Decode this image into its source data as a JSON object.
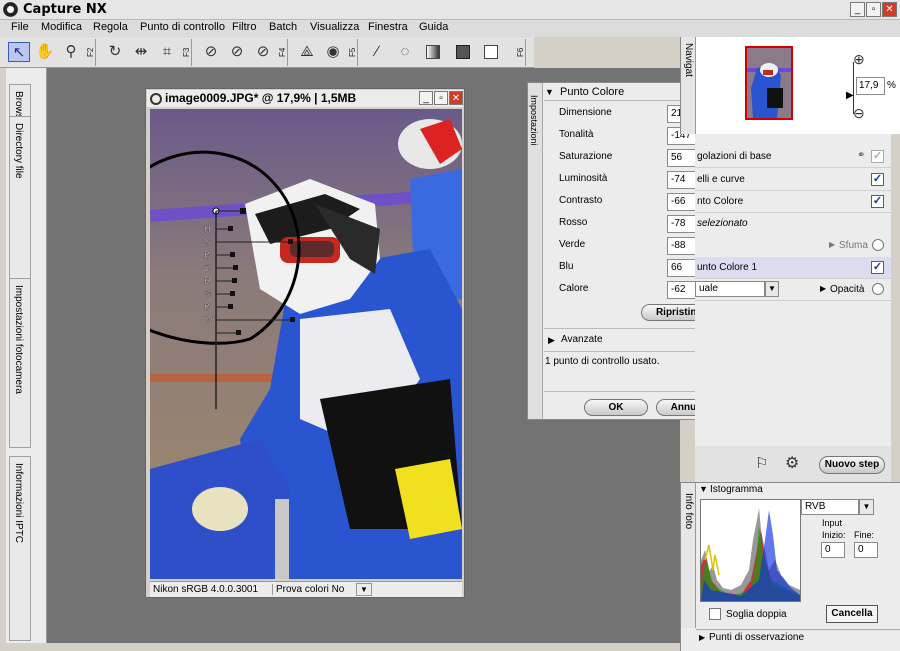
{
  "app": {
    "title": "Capture NX"
  },
  "window_controls": {
    "minimize": "_",
    "restore": "▫",
    "close": "✕"
  },
  "menu": [
    "File",
    "Modifica",
    "Regola",
    "Punto di controllo",
    "Filtro",
    "Batch",
    "Visualizza",
    "Finestra",
    "Guida"
  ],
  "toolbar": {
    "fkeys": [
      "F2",
      "F3",
      "F4",
      "F5",
      "F6"
    ]
  },
  "left_tabs": [
    "Browser",
    "Directory file",
    "Impostazioni fotocamera",
    "Informazioni IPTC"
  ],
  "image_window": {
    "title": "image0009.JPG* @ 17,9% | 1,5MB",
    "status_profile": "Nikon sRGB 4.0.0.3001",
    "status_proof": "Prova colori No",
    "control_point_letters": [
      "H",
      "S",
      "B",
      "C",
      "R",
      "G",
      "B",
      "W"
    ]
  },
  "color_point": {
    "side_tab": "Impostazioni",
    "header": "Punto Colore",
    "rows": [
      {
        "label": "Dimensione",
        "value": "21",
        "unit": "%"
      },
      {
        "label": "Tonalità",
        "value": "-147",
        "unit": "°"
      },
      {
        "label": "Saturazione",
        "value": "56",
        "unit": "%"
      },
      {
        "label": "Luminosità",
        "value": "-74",
        "unit": "%"
      },
      {
        "label": "Contrasto",
        "value": "-66",
        "unit": "%"
      },
      {
        "label": "Rosso",
        "value": "-78",
        "unit": ""
      },
      {
        "label": "Verde",
        "value": "-88",
        "unit": ""
      },
      {
        "label": "Blu",
        "value": "66",
        "unit": ""
      },
      {
        "label": "Calore",
        "value": "-62",
        "unit": ""
      }
    ],
    "reset_label": "Ripristina",
    "advanced_label": "Avanzate",
    "status": "1 punto di controllo usato.",
    "ok_label": "OK",
    "cancel_label": "Annulla"
  },
  "navigator": {
    "tab": "Navigat",
    "zoom": "17,9",
    "zoom_unit": "%"
  },
  "edit_list": {
    "items": [
      {
        "label": "golazioni di base",
        "checked": "✓"
      },
      {
        "label": "elli e curve",
        "checked": "✓"
      },
      {
        "label": "nto Colore",
        "checked": "✓"
      },
      {
        "label": "selezionato"
      },
      {
        "label": "Sfuma"
      },
      {
        "label": "unto Colore 1",
        "checked": "✓"
      },
      {
        "label": "uale",
        "label2": "Opacità"
      }
    ],
    "new_step_label": "Nuovo step"
  },
  "histogram": {
    "tab": "Info foto",
    "header": "Istogramma",
    "channel": "RVB",
    "input_label": "Input",
    "start_label": "Inizio:",
    "end_label": "Fine:",
    "start_value": "0",
    "end_value": "0",
    "double_threshold_label": "Soglia doppia",
    "clear_label": "Cancella",
    "observation_points_label": "Punti di osservazione"
  },
  "colors": {
    "accent": "#1a2d9a",
    "close_red": "#cc2a1a"
  }
}
